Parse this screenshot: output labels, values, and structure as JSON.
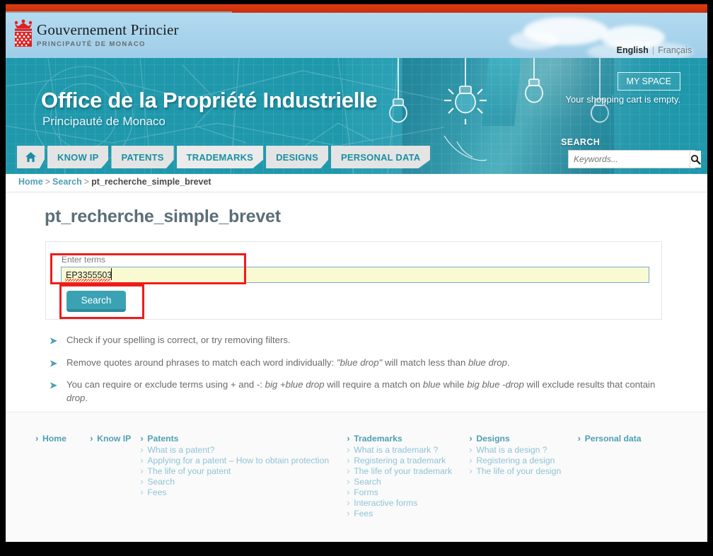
{
  "gov_header": {
    "logo_name": "monaco-coat-of-arms",
    "title": "Gouvernement Princier",
    "subtitle": "PRINCIPAUTÉ DE MONACO",
    "languages": {
      "active": "English",
      "separator": "|",
      "other": "Français"
    }
  },
  "banner": {
    "title": "Office de la Propriété Industrielle",
    "subtitle": "Principauté de Monaco",
    "my_space_label": "MY SPACE",
    "cart_text": "Your shopping cart is empty."
  },
  "nav": {
    "home_icon": "home-icon",
    "items": [
      {
        "label": "KNOW IP",
        "active": false
      },
      {
        "label": "PATENTS",
        "active": false
      },
      {
        "label": "TRADEMARKS",
        "active": true
      },
      {
        "label": "DESIGNS",
        "active": false
      },
      {
        "label": "PERSONAL DATA",
        "active": false
      }
    ]
  },
  "header_search": {
    "label": "SEARCH",
    "placeholder": "Keywords...",
    "value": "",
    "button_icon": "search-icon"
  },
  "breadcrumb": {
    "home": "Home",
    "sep1": ">",
    "search": "Search",
    "sep2": ">",
    "current": "pt_recherche_simple_brevet"
  },
  "main": {
    "page_title": "pt_recherche_simple_brevet",
    "form": {
      "field_label": "Enter terms",
      "field_value": "EP3355503",
      "submit_label": "Search"
    },
    "tips": [
      {
        "parts": [
          {
            "t": "Check if your spelling is correct, or try removing filters.",
            "i": false
          }
        ]
      },
      {
        "parts": [
          {
            "t": "Remove quotes around phrases to match each word individually: ",
            "i": false
          },
          {
            "t": "\"blue drop\"",
            "i": true
          },
          {
            "t": " will match less than ",
            "i": false
          },
          {
            "t": "blue drop",
            "i": true
          },
          {
            "t": ".",
            "i": false
          }
        ]
      },
      {
        "parts": [
          {
            "t": "You can require or exclude terms using + and -: ",
            "i": false
          },
          {
            "t": "big +blue drop",
            "i": true
          },
          {
            "t": " will require a match on ",
            "i": false
          },
          {
            "t": "blue",
            "i": true
          },
          {
            "t": " while ",
            "i": false
          },
          {
            "t": "big blue -drop",
            "i": true
          },
          {
            "t": " will exclude results that contain ",
            "i": false
          },
          {
            "t": "drop",
            "i": true
          },
          {
            "t": ".",
            "i": false
          }
        ]
      }
    ]
  },
  "footer": {
    "columns": [
      {
        "head": "Home",
        "links": []
      },
      {
        "head": "Know IP",
        "links": []
      },
      {
        "head": "Patents",
        "links": [
          "What is a patent?",
          "Applying for a patent – How to obtain protection",
          "The life of your patent",
          "Search",
          "Fees"
        ]
      },
      {
        "head": "Trademarks",
        "links": [
          "What is a trademark ?",
          "Registering a trademark",
          "The life of your trademark",
          "Search",
          "Forms",
          "Interactive forms",
          "Fees"
        ]
      },
      {
        "head": "Designs",
        "links": [
          "What is a design ?",
          "Registering a design",
          "The life of your design"
        ]
      },
      {
        "head": "Personal data",
        "links": []
      }
    ]
  },
  "annotations": {
    "color": "#ee1c1c",
    "boxes": [
      "terms-input-highlight",
      "search-button-highlight"
    ]
  },
  "colors": {
    "brand_teal": "#1f98ac",
    "link_teal": "#4f9fb5",
    "accent_red": "#dd3b12",
    "sky_blue": "#a8d3ec",
    "input_yellow": "#fafad2"
  }
}
